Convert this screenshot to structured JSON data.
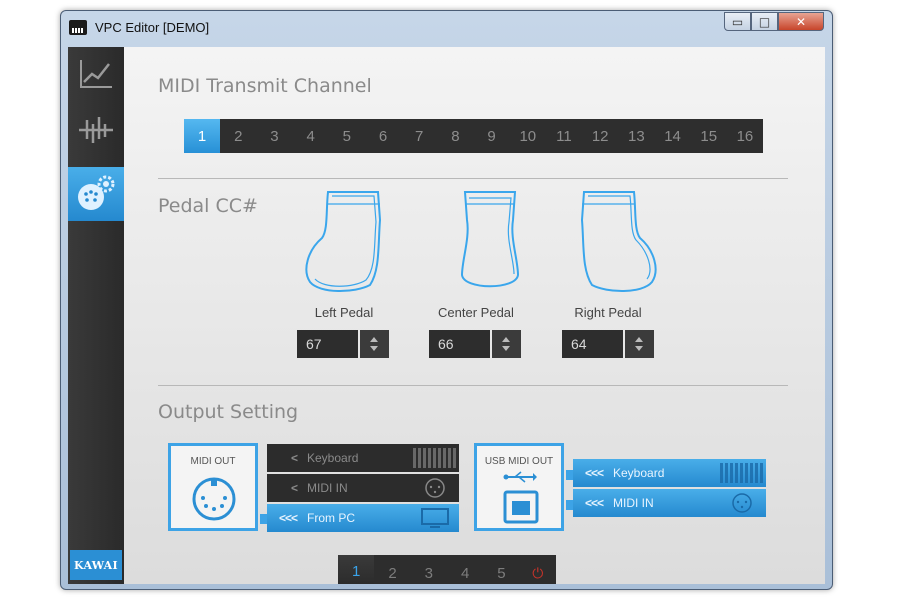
{
  "window": {
    "title": "VPC Editor [DEMO]",
    "minimize_glyph": "▭",
    "maximize_glyph": "□",
    "close_glyph": "✕"
  },
  "sidebar": {
    "items": [
      {
        "icon": "curve-graph-icon",
        "active": false
      },
      {
        "icon": "waveform-icon",
        "active": false
      },
      {
        "icon": "midi-gear-settings-icon",
        "active": true
      }
    ],
    "logo_text": "KAWAI"
  },
  "midi_transmit": {
    "title": "MIDI Transmit Channel",
    "channels": [
      "1",
      "2",
      "3",
      "4",
      "5",
      "6",
      "7",
      "8",
      "9",
      "10",
      "11",
      "12",
      "13",
      "14",
      "15",
      "16"
    ],
    "selected": "1"
  },
  "pedal": {
    "title": "Pedal CC#",
    "pedals": [
      {
        "label": "Left Pedal",
        "value": "67"
      },
      {
        "label": "Center Pedal",
        "value": "66"
      },
      {
        "label": "Right Pedal",
        "value": "64"
      }
    ]
  },
  "output": {
    "title": "Output Setting",
    "midi_out": {
      "label": "MIDI OUT",
      "routes": [
        {
          "arrows": "<",
          "label": "Keyboard",
          "active": false,
          "icon": "keyboard-icon"
        },
        {
          "arrows": "<",
          "label": "MIDI IN",
          "active": false,
          "icon": "midi-port-icon"
        },
        {
          "arrows": "<<<",
          "label": "From PC",
          "active": true,
          "icon": "monitor-icon"
        }
      ]
    },
    "usb_midi_out": {
      "label": "USB MIDI OUT",
      "routes": [
        {
          "arrows": "<<<",
          "label": "Keyboard",
          "active": true,
          "icon": "keyboard-icon"
        },
        {
          "arrows": "<<<",
          "label": "MIDI IN",
          "active": true,
          "icon": "midi-port-icon"
        }
      ]
    }
  },
  "pager": {
    "pages": [
      "1",
      "2",
      "3",
      "4",
      "5"
    ],
    "selected": "1",
    "power_icon": "power-icon",
    "power_glyph": "⏻"
  },
  "colors": {
    "accent": "#2b8fd4",
    "dark_panel": "#2d2d2d",
    "power": "#c8332a"
  }
}
